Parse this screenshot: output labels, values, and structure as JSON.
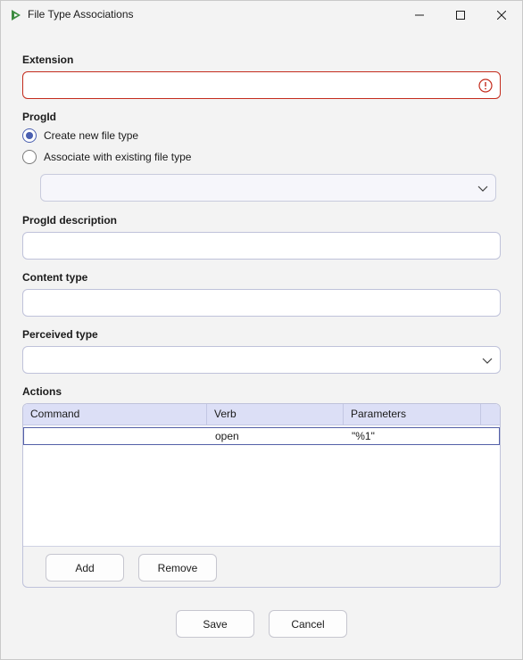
{
  "window": {
    "title": "File Type Associations"
  },
  "extension": {
    "label": "Extension",
    "value": ""
  },
  "progid": {
    "label": "ProgId",
    "options": [
      "Create new file type",
      "Associate with existing file type"
    ],
    "selected_index": 0,
    "existing_value": ""
  },
  "progid_description": {
    "label": "ProgId description",
    "value": ""
  },
  "content_type": {
    "label": "Content type",
    "value": ""
  },
  "perceived_type": {
    "label": "Perceived type",
    "value": ""
  },
  "actions": {
    "label": "Actions",
    "columns": [
      "Command",
      "Verb",
      "Parameters"
    ],
    "rows": [
      {
        "command": "",
        "verb": "open",
        "parameters": "\"%1\""
      }
    ],
    "add_label": "Add",
    "remove_label": "Remove"
  },
  "footer": {
    "save_label": "Save",
    "cancel_label": "Cancel"
  },
  "colors": {
    "accent": "#4a5fb0",
    "error": "#c42b1c",
    "header_bg": "#dcdff6"
  }
}
